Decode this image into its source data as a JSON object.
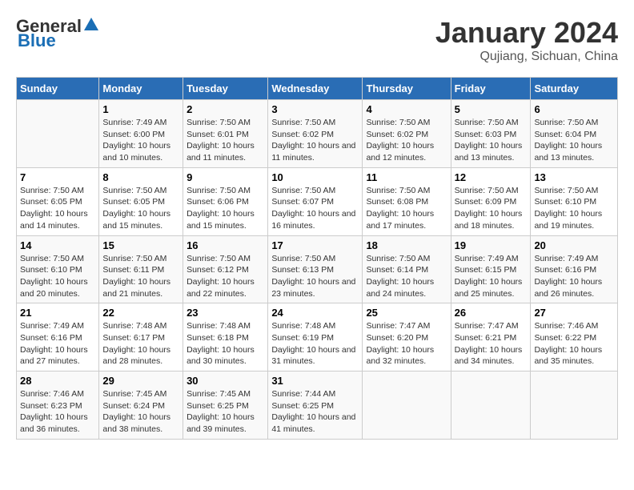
{
  "header": {
    "logo_general": "General",
    "logo_blue": "Blue",
    "month_title": "January 2024",
    "location": "Qujiang, Sichuan, China"
  },
  "columns": [
    "Sunday",
    "Monday",
    "Tuesday",
    "Wednesday",
    "Thursday",
    "Friday",
    "Saturday"
  ],
  "weeks": [
    [
      {
        "day": "",
        "info": ""
      },
      {
        "day": "1",
        "info": "Sunrise: 7:49 AM\nSunset: 6:00 PM\nDaylight: 10 hours and 10 minutes."
      },
      {
        "day": "2",
        "info": "Sunrise: 7:50 AM\nSunset: 6:01 PM\nDaylight: 10 hours and 11 minutes."
      },
      {
        "day": "3",
        "info": "Sunrise: 7:50 AM\nSunset: 6:02 PM\nDaylight: 10 hours and 11 minutes."
      },
      {
        "day": "4",
        "info": "Sunrise: 7:50 AM\nSunset: 6:02 PM\nDaylight: 10 hours and 12 minutes."
      },
      {
        "day": "5",
        "info": "Sunrise: 7:50 AM\nSunset: 6:03 PM\nDaylight: 10 hours and 13 minutes."
      },
      {
        "day": "6",
        "info": "Sunrise: 7:50 AM\nSunset: 6:04 PM\nDaylight: 10 hours and 13 minutes."
      }
    ],
    [
      {
        "day": "7",
        "info": "Sunrise: 7:50 AM\nSunset: 6:05 PM\nDaylight: 10 hours and 14 minutes."
      },
      {
        "day": "8",
        "info": "Sunrise: 7:50 AM\nSunset: 6:05 PM\nDaylight: 10 hours and 15 minutes."
      },
      {
        "day": "9",
        "info": "Sunrise: 7:50 AM\nSunset: 6:06 PM\nDaylight: 10 hours and 15 minutes."
      },
      {
        "day": "10",
        "info": "Sunrise: 7:50 AM\nSunset: 6:07 PM\nDaylight: 10 hours and 16 minutes."
      },
      {
        "day": "11",
        "info": "Sunrise: 7:50 AM\nSunset: 6:08 PM\nDaylight: 10 hours and 17 minutes."
      },
      {
        "day": "12",
        "info": "Sunrise: 7:50 AM\nSunset: 6:09 PM\nDaylight: 10 hours and 18 minutes."
      },
      {
        "day": "13",
        "info": "Sunrise: 7:50 AM\nSunset: 6:10 PM\nDaylight: 10 hours and 19 minutes."
      }
    ],
    [
      {
        "day": "14",
        "info": "Sunrise: 7:50 AM\nSunset: 6:10 PM\nDaylight: 10 hours and 20 minutes."
      },
      {
        "day": "15",
        "info": "Sunrise: 7:50 AM\nSunset: 6:11 PM\nDaylight: 10 hours and 21 minutes."
      },
      {
        "day": "16",
        "info": "Sunrise: 7:50 AM\nSunset: 6:12 PM\nDaylight: 10 hours and 22 minutes."
      },
      {
        "day": "17",
        "info": "Sunrise: 7:50 AM\nSunset: 6:13 PM\nDaylight: 10 hours and 23 minutes."
      },
      {
        "day": "18",
        "info": "Sunrise: 7:50 AM\nSunset: 6:14 PM\nDaylight: 10 hours and 24 minutes."
      },
      {
        "day": "19",
        "info": "Sunrise: 7:49 AM\nSunset: 6:15 PM\nDaylight: 10 hours and 25 minutes."
      },
      {
        "day": "20",
        "info": "Sunrise: 7:49 AM\nSunset: 6:16 PM\nDaylight: 10 hours and 26 minutes."
      }
    ],
    [
      {
        "day": "21",
        "info": "Sunrise: 7:49 AM\nSunset: 6:16 PM\nDaylight: 10 hours and 27 minutes."
      },
      {
        "day": "22",
        "info": "Sunrise: 7:48 AM\nSunset: 6:17 PM\nDaylight: 10 hours and 28 minutes."
      },
      {
        "day": "23",
        "info": "Sunrise: 7:48 AM\nSunset: 6:18 PM\nDaylight: 10 hours and 30 minutes."
      },
      {
        "day": "24",
        "info": "Sunrise: 7:48 AM\nSunset: 6:19 PM\nDaylight: 10 hours and 31 minutes."
      },
      {
        "day": "25",
        "info": "Sunrise: 7:47 AM\nSunset: 6:20 PM\nDaylight: 10 hours and 32 minutes."
      },
      {
        "day": "26",
        "info": "Sunrise: 7:47 AM\nSunset: 6:21 PM\nDaylight: 10 hours and 34 minutes."
      },
      {
        "day": "27",
        "info": "Sunrise: 7:46 AM\nSunset: 6:22 PM\nDaylight: 10 hours and 35 minutes."
      }
    ],
    [
      {
        "day": "28",
        "info": "Sunrise: 7:46 AM\nSunset: 6:23 PM\nDaylight: 10 hours and 36 minutes."
      },
      {
        "day": "29",
        "info": "Sunrise: 7:45 AM\nSunset: 6:24 PM\nDaylight: 10 hours and 38 minutes."
      },
      {
        "day": "30",
        "info": "Sunrise: 7:45 AM\nSunset: 6:25 PM\nDaylight: 10 hours and 39 minutes."
      },
      {
        "day": "31",
        "info": "Sunrise: 7:44 AM\nSunset: 6:25 PM\nDaylight: 10 hours and 41 minutes."
      },
      {
        "day": "",
        "info": ""
      },
      {
        "day": "",
        "info": ""
      },
      {
        "day": "",
        "info": ""
      }
    ]
  ]
}
